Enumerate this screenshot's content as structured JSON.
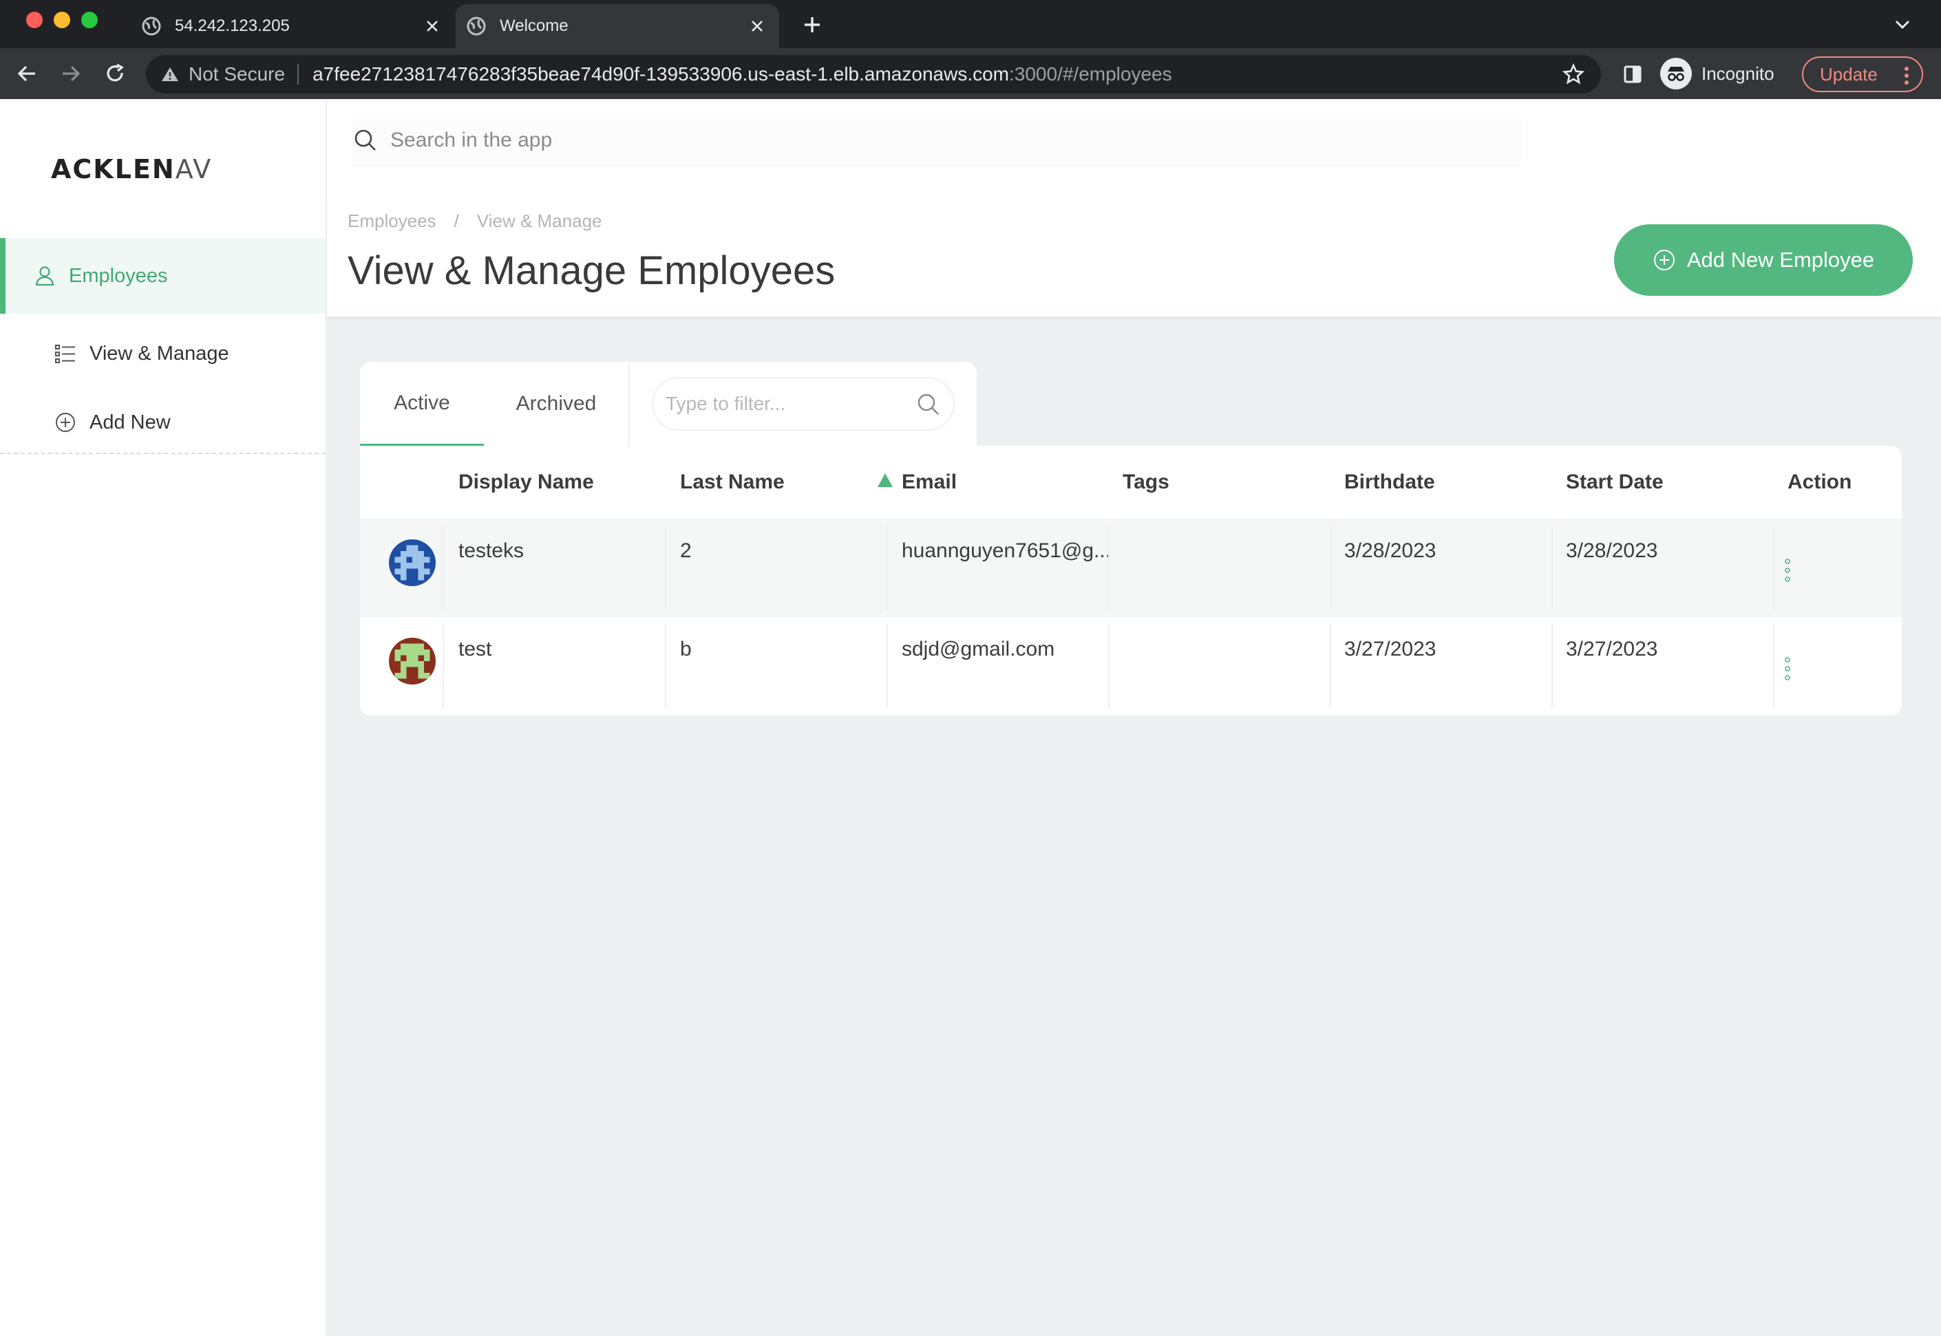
{
  "browser": {
    "tabs": [
      {
        "title": "54.242.123.205",
        "active": false
      },
      {
        "title": "Welcome",
        "active": true
      }
    ],
    "security_label": "Not Secure",
    "url_host": "a7fee27123817476283f35beae74d90f-139533906.us-east-1.elb.amazonaws.com",
    "url_path": ":3000/#/employees",
    "profile_label": "Incognito",
    "update_label": "Update"
  },
  "sidebar": {
    "logo_bold": "ACKLEN",
    "logo_light": "AV",
    "items": [
      {
        "label": "Employees",
        "icon": "person-icon",
        "active": true
      },
      {
        "label": "View & Manage",
        "icon": "list-icon",
        "active": false
      },
      {
        "label": "Add New",
        "icon": "plus-circle-icon",
        "active": false
      }
    ]
  },
  "search": {
    "placeholder": "Search in the app"
  },
  "header": {
    "breadcrumb": [
      "Employees",
      "/",
      "View & Manage"
    ],
    "title": "View & Manage Employees",
    "add_button": "Add New Employee"
  },
  "tabs": {
    "active_label": "Active",
    "archived_label": "Archived",
    "filter_placeholder": "Type to filter..."
  },
  "table": {
    "columns": [
      "Display Name",
      "Last Name",
      "Email",
      "Tags",
      "Birthdate",
      "Start Date",
      "Action"
    ],
    "sorted_column": "Email",
    "rows": [
      {
        "display_name": "testeks",
        "last_name": "2",
        "email": "huannguyen7651@g...",
        "tags": "",
        "birthdate": "3/28/2023",
        "start_date": "3/28/2023",
        "avatar_color": "#1f4fa3"
      },
      {
        "display_name": "test",
        "last_name": "b",
        "email": "sdjd@gmail.com",
        "tags": "",
        "birthdate": "3/27/2023",
        "start_date": "3/27/2023",
        "avatar_color": "#8a2f1e"
      }
    ]
  },
  "colors": {
    "accent": "#4cb87c",
    "button": "#52b880"
  }
}
